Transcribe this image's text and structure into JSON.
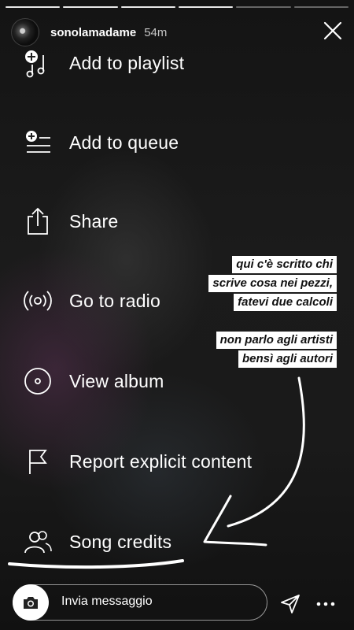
{
  "story": {
    "username": "sonolamadame",
    "time": "54m",
    "segments_total": 6,
    "segments_done": 4
  },
  "menu": {
    "items": [
      {
        "label": "Add to playlist",
        "icon": "add-to-playlist-icon"
      },
      {
        "label": "Add to queue",
        "icon": "add-to-queue-icon"
      },
      {
        "label": "Share",
        "icon": "share-icon"
      },
      {
        "label": "Go to radio",
        "icon": "radio-icon"
      },
      {
        "label": "View album",
        "icon": "album-icon"
      },
      {
        "label": "Report explicit content",
        "icon": "flag-icon"
      },
      {
        "label": "Song credits",
        "icon": "song-credits-icon"
      }
    ]
  },
  "caption": {
    "block1": [
      "qui c'è scritto chi",
      "scrive cosa nei pezzi,",
      "fatevi due calcoli"
    ],
    "block2": [
      "non parlo agli artisti",
      "bensì agli autori"
    ]
  },
  "bottom": {
    "message_placeholder": "Invia messaggio"
  },
  "colors": {
    "text": "#ffffff",
    "caption_bg": "#ffffff",
    "caption_text": "#111111"
  }
}
